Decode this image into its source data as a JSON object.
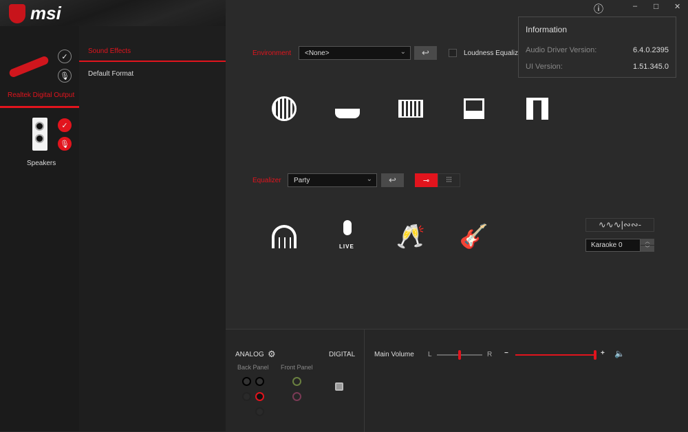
{
  "brand": {
    "logo_text": "msi"
  },
  "window_controls": {
    "info": "ⓘ",
    "minimize": "–",
    "maximize": "□",
    "close": "✕"
  },
  "devices": [
    {
      "label": "Realtek Digital Output",
      "active": true
    },
    {
      "label": "Speakers",
      "active": false
    }
  ],
  "nav": {
    "items": [
      {
        "label": "Sound Effects",
        "active": true
      },
      {
        "label": "Default Format",
        "active": false
      }
    ]
  },
  "environment": {
    "label": "Environment",
    "value": "<None>",
    "loudness_label": "Loudness Equalizat",
    "loudness_checked": false,
    "presets": [
      "stone-room-icon",
      "bathroom-icon",
      "colosseum-icon",
      "arena-icon",
      "theater-icon"
    ]
  },
  "equalizer": {
    "label": "Equalizer",
    "value": "Party",
    "modes": [
      "trumpet-icon",
      "sliders-icon"
    ],
    "presets": [
      "headphones-icon",
      "live-mic-icon",
      "cheers-icon",
      "guitar-icon"
    ]
  },
  "karaoke": {
    "value": "Karaoke 0"
  },
  "info_popup": {
    "title": "Information",
    "rows": [
      {
        "label": "Audio Driver Version:",
        "value": "6.4.0.2395"
      },
      {
        "label": "UI Version:",
        "value": "1.51.345.0"
      }
    ]
  },
  "bottom": {
    "analog": "ANALOG",
    "digital": "DIGITAL",
    "back_panel": "Back Panel",
    "front_panel": "Front Panel",
    "main_volume": "Main Volume",
    "balance_left": "L",
    "balance_right": "R",
    "minus": "−",
    "plus": "+",
    "balance_value": 0.5,
    "volume_value": 1.0
  },
  "colors": {
    "accent": "#e2141d",
    "background": "#2a2a2a"
  }
}
